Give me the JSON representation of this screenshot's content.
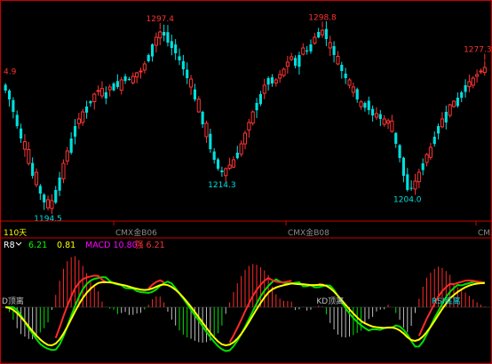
{
  "chart_data": [
    {
      "type": "candlestick",
      "x_labels": [
        "CMX金B06",
        "CMX金B08",
        "CMX"
      ],
      "price_labels": [
        {
          "index": 0,
          "text": "4.9",
          "kind": "high"
        },
        {
          "index": 11,
          "text": "1194.5",
          "kind": "low"
        },
        {
          "index": 40,
          "text": "1297.4",
          "kind": "high"
        },
        {
          "index": 56,
          "text": "1214.3",
          "kind": "low"
        },
        {
          "index": 82,
          "text": "1298.8",
          "kind": "high"
        },
        {
          "index": 104,
          "text": "1204.0",
          "kind": "low"
        },
        {
          "index": 124,
          "text": "1277.3",
          "kind": "high"
        }
      ],
      "period_label": "110天",
      "up_color": "#ff3333",
      "down_color": "#00e0e0",
      "ylim": [
        1190,
        1310
      ],
      "closes": [
        1263,
        1258,
        1251,
        1243,
        1236,
        1230,
        1222,
        1215,
        1210,
        1205,
        1200,
        1197,
        1201,
        1207,
        1214,
        1222,
        1229,
        1236,
        1243,
        1247,
        1251,
        1254,
        1257,
        1261,
        1263,
        1260,
        1262,
        1265,
        1267,
        1265,
        1269,
        1271,
        1269,
        1271,
        1273,
        1274,
        1278,
        1283,
        1289,
        1293,
        1296,
        1294,
        1290,
        1287,
        1284,
        1280,
        1275,
        1270,
        1265,
        1258,
        1251,
        1244,
        1237,
        1230,
        1224,
        1219,
        1217,
        1219,
        1221,
        1224,
        1228,
        1233,
        1239,
        1245,
        1251,
        1256,
        1261,
        1266,
        1270,
        1267,
        1269,
        1272,
        1275,
        1279,
        1282,
        1277,
        1283,
        1287,
        1285,
        1289,
        1293,
        1296,
        1297,
        1292,
        1287,
        1283,
        1278,
        1274,
        1270,
        1266,
        1262,
        1258,
        1254,
        1256,
        1252,
        1249,
        1250,
        1247,
        1244,
        1246,
        1240,
        1233,
        1225,
        1215,
        1207,
        1208,
        1212,
        1217,
        1222,
        1227,
        1231,
        1237,
        1243,
        1247,
        1251,
        1255,
        1254,
        1259,
        1262,
        1266,
        1268,
        1270,
        1272,
        1274,
        1276
      ]
    },
    {
      "type": "macd",
      "header": {
        "name": "R8",
        "v1_label": "6.21",
        "v2_label": "0.81",
        "macd_label": "MACD 10.80",
        "ext_label": "强 6.21"
      },
      "annotations": [
        {
          "index": 0,
          "text": "D顶离"
        },
        {
          "index": 84,
          "text": "KD顶离"
        },
        {
          "index": 114,
          "text": "RSI底离"
        }
      ],
      "colors": {
        "fast": "#ff2a2a",
        "slow": "#00e000",
        "signal": "#ffff00",
        "hist_pos": "#ff2a2a",
        "hist_neg": "#c0c0c0",
        "hist_neg_green": "#00e000",
        "v1": "#00ff00",
        "v2": "#ffff00",
        "macd": "#ff00ff",
        "ext": "#ff3333"
      }
    }
  ]
}
